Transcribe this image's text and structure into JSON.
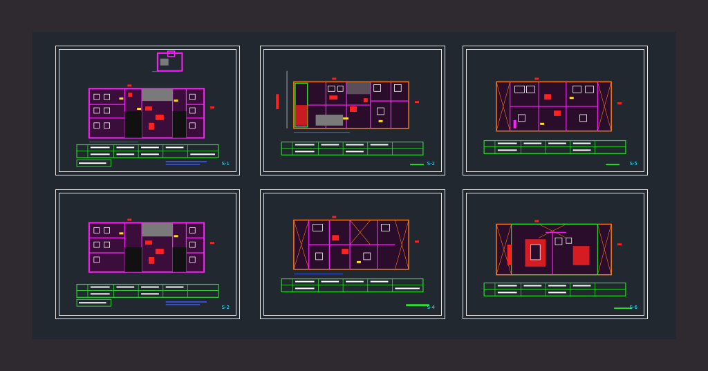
{
  "viewer": {
    "background_color": "#2f2a2f",
    "model_space_color": "#212830",
    "sheet_border_color": "#e9e9e9"
  },
  "colors": {
    "wall_magenta": "#ff1fff",
    "red": "#ff2020",
    "green": "#2bdc2b",
    "yellow": "#ffe020",
    "cyan": "#39e6ff",
    "white": "#ffffff",
    "orange": "#ff7a1a",
    "blue": "#3a5bff"
  },
  "sheets": [
    {
      "number": "S-1"
    },
    {
      "number": "S-2"
    },
    {
      "number": "S-5"
    },
    {
      "number": "S-2"
    },
    {
      "number": "S-4"
    },
    {
      "number": "S-6"
    }
  ]
}
